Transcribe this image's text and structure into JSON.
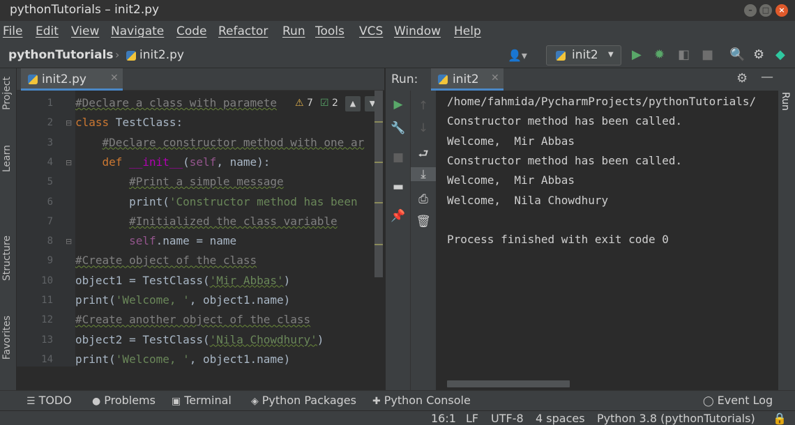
{
  "window": {
    "title": "pythonTutorials – init2.py"
  },
  "menu": [
    "File",
    "Edit",
    "View",
    "Navigate",
    "Code",
    "Refactor",
    "Run",
    "Tools",
    "VCS",
    "Window",
    "Help"
  ],
  "nav": {
    "project": "pythonTutorials",
    "file": "init2.py",
    "run_config": "init2"
  },
  "editor": {
    "tab_label": "init2.py",
    "inspections": {
      "warnings": "7",
      "weak_warnings": "2"
    },
    "line_numbers": [
      "1",
      "2",
      "3",
      "4",
      "5",
      "6",
      "7",
      "8",
      "9",
      "10",
      "11",
      "12",
      "13",
      "14"
    ],
    "lines": [
      {
        "indent": "",
        "tokens": [
          {
            "t": "#Declare a class with paramete",
            "c": "c-com"
          }
        ]
      },
      {
        "indent": "",
        "tokens": [
          {
            "t": "class",
            "c": "c-kw"
          },
          {
            "t": " TestClass:",
            "c": "c-fn"
          }
        ]
      },
      {
        "indent": "    ",
        "tokens": [
          {
            "t": "#Declare constructor method with one ar",
            "c": "c-com"
          }
        ]
      },
      {
        "indent": "    ",
        "tokens": [
          {
            "t": "def",
            "c": "c-kw"
          },
          {
            "t": " ",
            "c": "c-fn"
          },
          {
            "t": "__init__",
            "c": "c-dunder"
          },
          {
            "t": "(",
            "c": "c-fn"
          },
          {
            "t": "self",
            "c": "c-self"
          },
          {
            "t": ", name):",
            "c": "c-fn"
          }
        ]
      },
      {
        "indent": "        ",
        "tokens": [
          {
            "t": "#Print a simple message",
            "c": "c-com"
          }
        ]
      },
      {
        "indent": "        ",
        "tokens": [
          {
            "t": "print(",
            "c": "c-fn"
          },
          {
            "t": "'Constructor method has been",
            "c": "c-str"
          }
        ]
      },
      {
        "indent": "        ",
        "tokens": [
          {
            "t": "#Initialized the class variable",
            "c": "c-com"
          }
        ]
      },
      {
        "indent": "        ",
        "tokens": [
          {
            "t": "self",
            "c": "c-self"
          },
          {
            "t": ".name = name",
            "c": "c-fn"
          }
        ]
      },
      {
        "indent": "",
        "tokens": [
          {
            "t": "#Create object of the class",
            "c": "c-com"
          }
        ]
      },
      {
        "indent": "",
        "tokens": [
          {
            "t": "object1 = TestClass(",
            "c": "c-fn"
          },
          {
            "t": "'Mir Abbas'",
            "c": "c-str-w"
          },
          {
            "t": ")",
            "c": "c-fn"
          }
        ]
      },
      {
        "indent": "",
        "tokens": [
          {
            "t": "print(",
            "c": "c-fn"
          },
          {
            "t": "'Welcome, '",
            "c": "c-str"
          },
          {
            "t": ", object1.name)",
            "c": "c-fn"
          }
        ]
      },
      {
        "indent": "",
        "tokens": [
          {
            "t": "#Create another object of the class",
            "c": "c-com"
          }
        ]
      },
      {
        "indent": "",
        "tokens": [
          {
            "t": "object2 = TestClass(",
            "c": "c-fn"
          },
          {
            "t": "'Nila Chowdhury'",
            "c": "c-str-w"
          },
          {
            "t": ")",
            "c": "c-fn"
          }
        ]
      },
      {
        "indent": "",
        "tokens": [
          {
            "t": "print(",
            "c": "c-fn"
          },
          {
            "t": "'Welcome, '",
            "c": "c-str"
          },
          {
            "t": ", object1.name)",
            "c": "c-fn"
          }
        ]
      }
    ]
  },
  "run_panel": {
    "title": "Run:",
    "tab_label": "init2",
    "output": [
      "/home/fahmida/PycharmProjects/pythonTutorials/",
      "Constructor method has been called.",
      "Welcome,  Mir Abbas",
      "Constructor method has been called.",
      "Welcome,  Mir Abbas",
      "Welcome,  Nila Chowdhury",
      "",
      "Process finished with exit code 0"
    ]
  },
  "side_tabs": {
    "project": "Project",
    "learn": "Learn",
    "structure": "Structure",
    "favorites": "Favorites",
    "run": "Run"
  },
  "bottom_tabs": [
    "TODO",
    "Problems",
    "Terminal",
    "Python Packages",
    "Python Console"
  ],
  "event_log": "Event Log",
  "status": {
    "position": "16:1",
    "line_sep": "LF",
    "encoding": "UTF-8",
    "indent": "4 spaces",
    "interpreter": "Python 3.8 (pythonTutorials)"
  },
  "colors": {
    "accent": "#4a88c7",
    "run_green": "#59a869",
    "close_orange": "#e05a2b"
  }
}
